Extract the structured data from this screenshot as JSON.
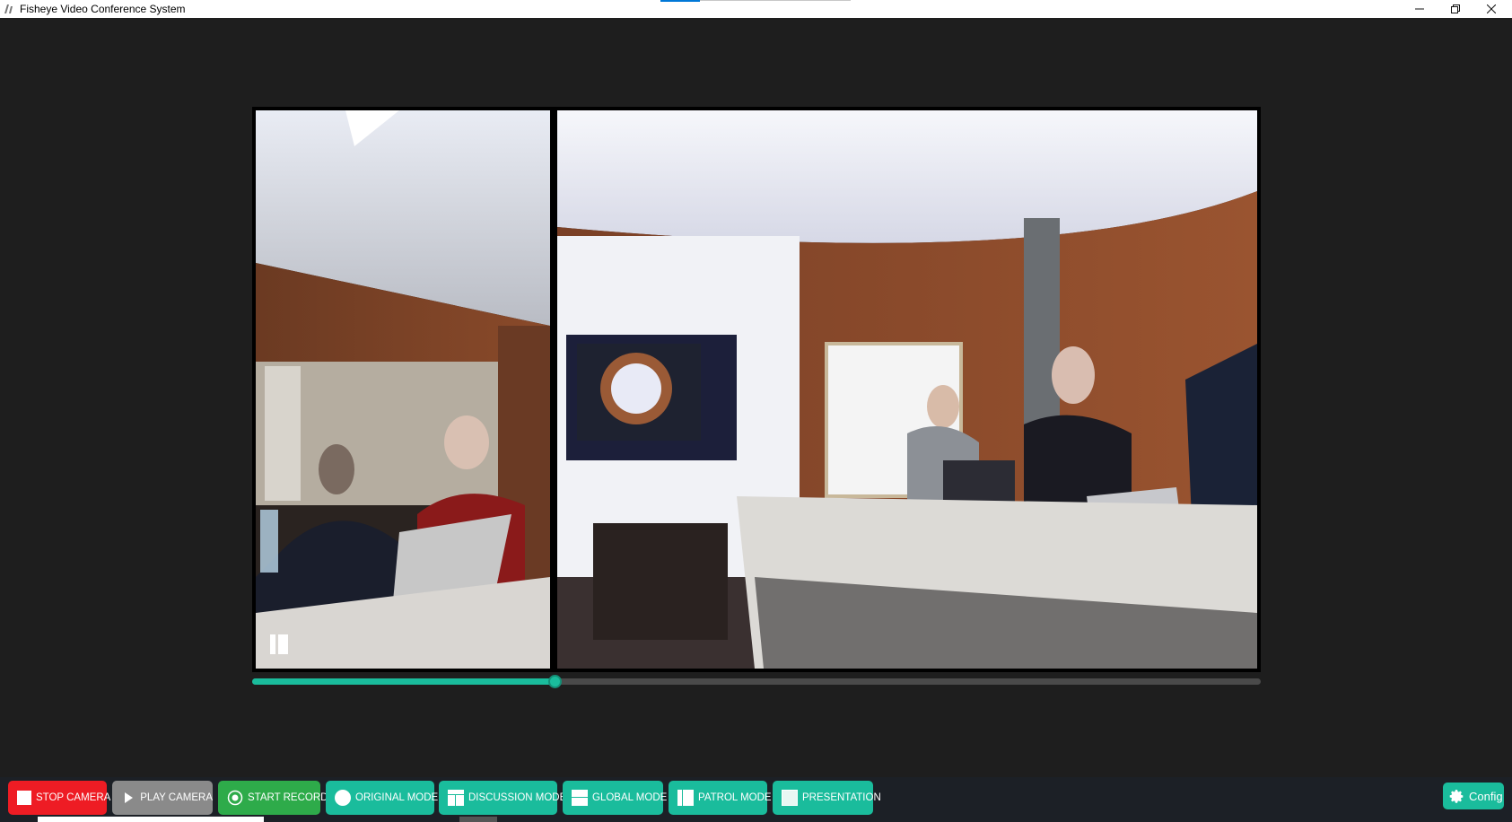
{
  "window": {
    "title": "Fisheye Video Conference System",
    "minimize_icon": "minimize-icon",
    "restore_icon": "restore-icon",
    "close_icon": "close-icon"
  },
  "video": {
    "left_pane": "camera-view-left",
    "right_pane": "camera-view-right",
    "pause_icon": "pause-icon"
  },
  "progress": {
    "fraction": 0.3
  },
  "toolbar": {
    "stop_camera": "STOP CAMERA",
    "play_camera": "PLAY CAMERA",
    "start_record": "START RECORD",
    "original_mode": "ORIGINAL MODE",
    "discussion_mode": "DISCUSSION MODE",
    "global_mode": "GLOBAL MODE",
    "patrol_mode": "PATROL MODE",
    "presentation": "PRESENTATION",
    "config": "Config"
  },
  "colors": {
    "stop": "#ee1c24",
    "play": "#8a8a8a",
    "record": "#2eab4a",
    "accent": "#1abc9c",
    "background": "#1e1e1e"
  }
}
